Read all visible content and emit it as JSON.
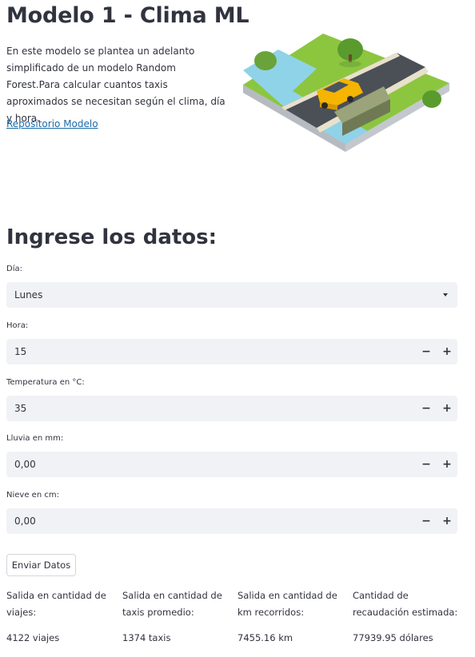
{
  "header": {
    "title": "Modelo 1 - Clima ML",
    "intro": "En este modelo se plantea un adelanto simplificado de un modelo Random Forest.Para calcular cuantos taxis aproximados se necesitan según el clima, día y hora.",
    "repo_link": "Repositorio Modelo"
  },
  "illustration": {
    "name": "taxi-on-bridge-illustration"
  },
  "form": {
    "heading": "Ingrese los datos:",
    "dia": {
      "label": "Día:",
      "value": "Lunes"
    },
    "hora": {
      "label": "Hora:",
      "value": "15"
    },
    "temperatura": {
      "label": "Temperatura en °C:",
      "value": "35"
    },
    "lluvia": {
      "label": "Lluvia en mm:",
      "value": "0,00"
    },
    "nieve": {
      "label": "Nieve en cm:",
      "value": "0,00"
    },
    "minus_symbol": "−",
    "plus_symbol": "+",
    "submit_label": "Enviar Datos"
  },
  "results": [
    {
      "label": "Salida en cantidad de viajes:",
      "value": "4122 viajes"
    },
    {
      "label": "Salida en cantidad de taxis promedio:",
      "value": "1374 taxis"
    },
    {
      "label": "Salida en cantidad de km recorridos:",
      "value": "7455.16 km"
    },
    {
      "label": "Cantidad de recaudación estimada:",
      "value": "77939.95 dólares"
    }
  ],
  "colors": {
    "accent_link": "#1a6aa6",
    "input_bg": "#f0f2f6",
    "taxi_yellow": "#f5b400",
    "grass_green": "#8cc63f",
    "water_blue": "#8fd3e8"
  }
}
